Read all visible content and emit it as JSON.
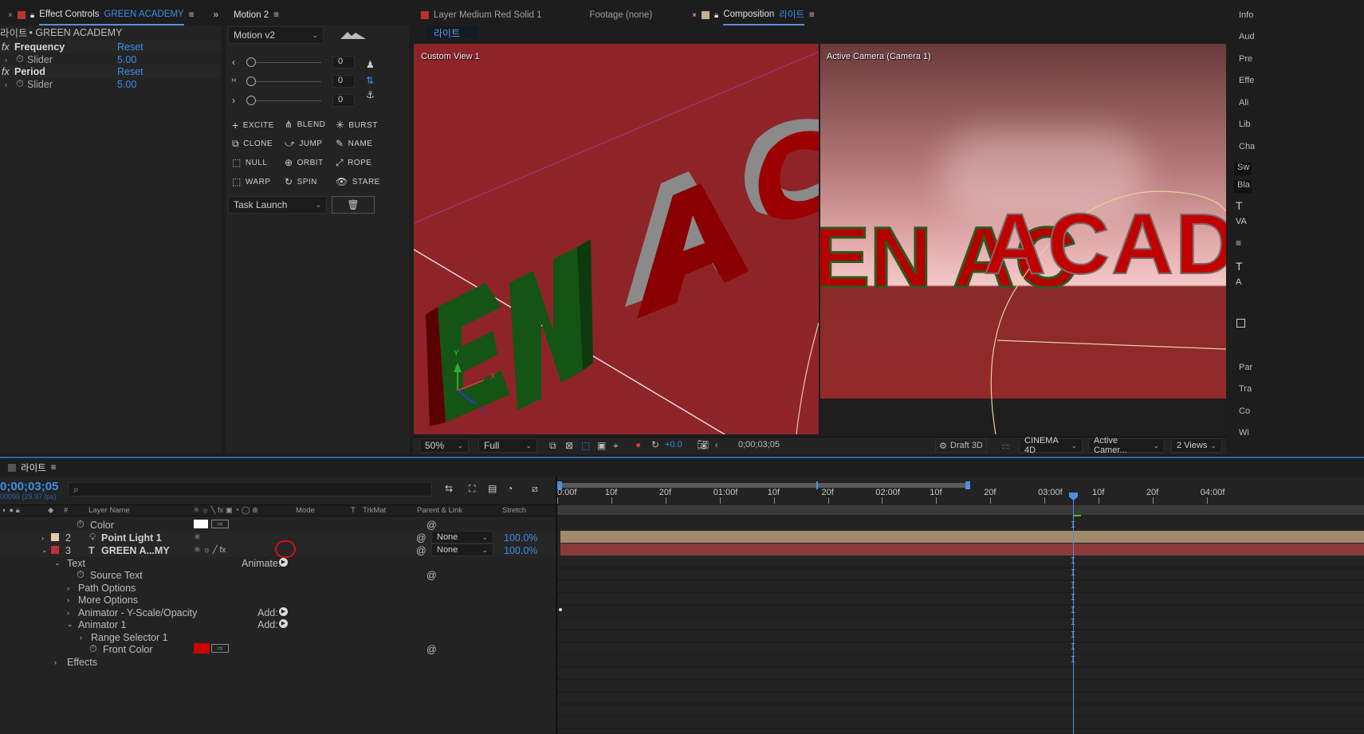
{
  "effect_controls": {
    "tab_label": "Effect Controls",
    "tab_layer": "GREEN ACADEMY",
    "crumb_prefix": "라이트",
    "crumb": "• GREEN ACADEMY",
    "effects": [
      {
        "name": "Frequency",
        "reset": "Reset",
        "prop": "Slider",
        "value": "5.00"
      },
      {
        "name": "Period",
        "reset": "Reset",
        "prop": "Slider",
        "value": "5.00"
      }
    ]
  },
  "motion": {
    "tab_label": "Motion 2",
    "preset": "Motion v2",
    "slider_values": [
      "0",
      "0",
      "0"
    ],
    "buttons": [
      "EXCITE",
      "BLEND",
      "BURST",
      "CLONE",
      "JUMP",
      "NAME",
      "NULL",
      "ORBIT",
      "ROPE",
      "WARP",
      "SPIN",
      "STARE"
    ],
    "task": "Task Launch"
  },
  "viewer": {
    "tab_layer": "Layer  Medium Red Solid 1",
    "tab_footage": "Footage  (none)",
    "tab_comp_prefix": "Composition",
    "tab_comp_name": "라이트",
    "comp_chip": "라이트",
    "left_view_label": "Custom View 1",
    "right_view_label": "Active Camera (Camera 1)",
    "left_text": "EN AC",
    "right_text": "EN ACAD",
    "axis": {
      "y": "Y",
      "x": "X",
      "z": "Z"
    },
    "zoom": "50%",
    "resolution": "Full",
    "exposure": "+0.0",
    "timecode": "0;00;03;05",
    "draft3d": "Draft 3D",
    "renderer": "CINEMA 4D",
    "camera": "Active Camer...",
    "views": "2 Views"
  },
  "right_strip": [
    "Info",
    "Aud",
    "Pre",
    "Effe",
    "Ali",
    "Lib",
    "Cha",
    "Sw",
    "Bla",
    "Par",
    "Tra",
    "Co",
    "Wi"
  ],
  "timeline": {
    "tab_label": "라이트",
    "timecode": "0;00;03;05",
    "fps": "00095 (29.97 fps)",
    "columns": {
      "layer_name": "Layer Name",
      "mode": "Mode",
      "t": "T",
      "trkmat": "TrkMat",
      "parent": "Parent & Link",
      "stretch": "Stretch"
    },
    "rows": [
      {
        "indent": 1,
        "label": "Color",
        "kind": "prop"
      },
      {
        "num": "2",
        "label": "Point Light 1",
        "parent": "None",
        "stretch": "100.0%",
        "kind": "layer"
      },
      {
        "num": "3",
        "label": "GREEN A...MY",
        "parent": "None",
        "stretch": "100.0%",
        "kind": "layer"
      },
      {
        "label": "Text",
        "animate": "Animate:",
        "kind": "group"
      },
      {
        "label": "Source Text",
        "kind": "prop"
      },
      {
        "label": "Path Options",
        "kind": "group"
      },
      {
        "label": "More Options",
        "kind": "group"
      },
      {
        "label": "Animator - Y-Scale/Opacity",
        "add": "Add:",
        "kind": "group"
      },
      {
        "label": "Animator 1",
        "add": "Add:",
        "kind": "group"
      },
      {
        "label": "Range Selector 1",
        "kind": "group"
      },
      {
        "label": "Front Color",
        "kind": "prop"
      },
      {
        "label": "Effects",
        "kind": "group"
      }
    ],
    "ruler": [
      "0:00f",
      "10f",
      "20f",
      "01:00f",
      "10f",
      "20f",
      "02:00f",
      "10f",
      "20f",
      "03:00f",
      "10f",
      "20f",
      "04:00f"
    ],
    "colors": {
      "light_bar": "#a08a6c",
      "text_bar": "#8a3a3a",
      "playhead": "#4a90e2",
      "accent": "#3b8eea"
    }
  }
}
